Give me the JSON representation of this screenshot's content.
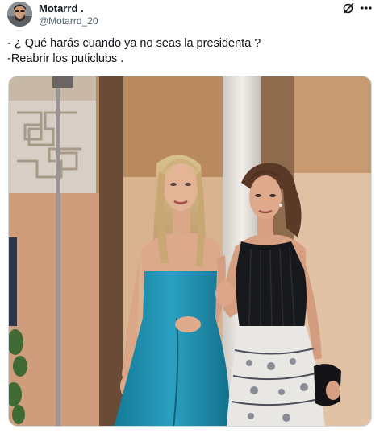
{
  "tweet": {
    "author_name": "Motarrd .",
    "author_handle": "@Motarrd_20",
    "lines": [
      "- ¿ Qué harás cuando ya no seas la presidenta ?",
      "-Reabrir los puticlubs ."
    ]
  },
  "icons": {
    "grok": "grok-icon",
    "more": "more-dots-icon"
  },
  "colors": {
    "text": "#0f1419",
    "secondary": "#536471",
    "border": "#cfd9de",
    "teal_dress": "#1c8fae",
    "black_top": "#17181c"
  }
}
